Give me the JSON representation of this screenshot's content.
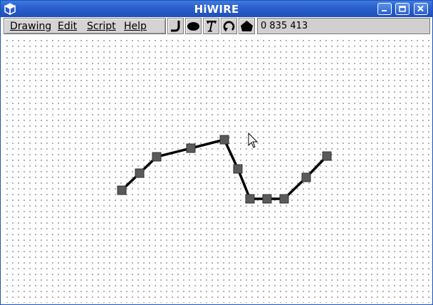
{
  "window": {
    "title": "HiWIRE",
    "app_icon": "cube-icon",
    "controls": {
      "minimize": "minimize-icon",
      "maximize": "maximize-icon",
      "close": "close-icon"
    }
  },
  "menu": {
    "items": [
      {
        "label": "Drawing",
        "name": "menu-drawing"
      },
      {
        "label": "Edit",
        "name": "menu-edit"
      },
      {
        "label": "Script",
        "name": "menu-script"
      },
      {
        "label": "Help",
        "name": "menu-help"
      }
    ]
  },
  "tools": [
    {
      "name": "wire-tool",
      "icon": "wire-icon"
    },
    {
      "name": "ellipse-tool",
      "icon": "ellipse-icon"
    },
    {
      "name": "text-tool",
      "icon": "text-icon",
      "glyph": "T"
    },
    {
      "name": "rotate-tool",
      "icon": "rotate-icon"
    },
    {
      "name": "shape-tool",
      "icon": "polygon-icon"
    }
  ],
  "status": {
    "coordinates": "0 835 413"
  },
  "colors": {
    "titlebar": "#2558c3",
    "handle_fill": "#5a5a5a",
    "wire": "#000000",
    "grid_dot": "#6a6a6a"
  },
  "canvas": {
    "cursor": "arrow-cursor-icon"
  }
}
